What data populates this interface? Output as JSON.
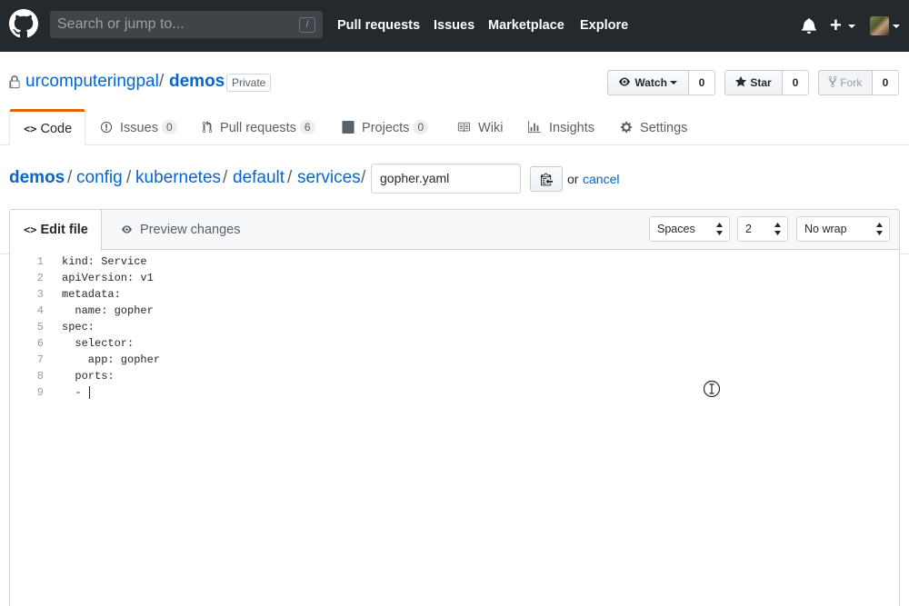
{
  "header": {
    "search_placeholder": "Search or jump to...",
    "search_shortcut": "/",
    "nav": [
      "Pull requests",
      "Issues",
      "Marketplace",
      "Explore"
    ],
    "plus": "+"
  },
  "repo": {
    "owner": "urcomputeringpal",
    "separator": "/",
    "name": "demos",
    "visibility": "Private",
    "watch_label": "Watch",
    "watch_count": "0",
    "star_label": "Star",
    "star_count": "0",
    "fork_label": "Fork",
    "fork_count": "0"
  },
  "tabs": {
    "code": "Code",
    "issues": "Issues",
    "issues_count": "0",
    "pulls": "Pull requests",
    "pulls_count": "6",
    "projects": "Projects",
    "projects_count": "0",
    "wiki": "Wiki",
    "insights": "Insights",
    "settings": "Settings"
  },
  "breadcrumb": {
    "items": [
      "demos",
      "config",
      "kubernetes",
      "default",
      "services"
    ],
    "sep": "/",
    "filename": "gopher.yaml",
    "or": "or",
    "cancel": "cancel"
  },
  "editor": {
    "edit_tab": "Edit file",
    "preview_tab": "Preview changes",
    "indent_mode": "Spaces",
    "indent_size": "2",
    "wrap_mode": "No wrap",
    "line_numbers": [
      "1",
      "2",
      "3",
      "4",
      "5",
      "6",
      "7",
      "8",
      "9"
    ],
    "lines": [
      "kind: Service",
      "apiVersion: v1",
      "metadata:",
      "  name: gopher",
      "spec:",
      "  selector:",
      "    app: gopher",
      "  ports:",
      "  - "
    ]
  },
  "colors": {
    "header_bg": "#24292e",
    "link": "#0366d6",
    "tab_accent": "#e36209"
  }
}
